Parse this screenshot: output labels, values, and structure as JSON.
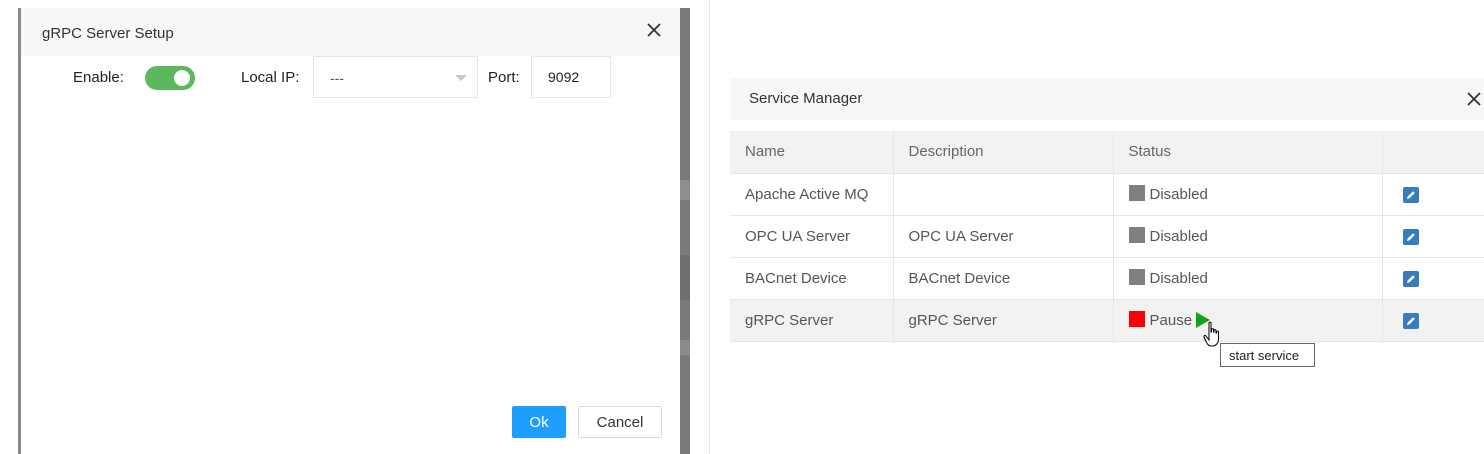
{
  "grpc_dialog": {
    "title": "gRPC Server Setup",
    "enable_label": "Enable:",
    "enabled": true,
    "local_ip_label": "Local IP:",
    "local_ip_value": "---",
    "port_label": "Port:",
    "port_value": "9092",
    "ok_label": "Ok",
    "cancel_label": "Cancel",
    "accent_color": "#1e9fff",
    "toggle_color": "#5cb85c"
  },
  "service_manager": {
    "title": "Service Manager",
    "columns": [
      "Name",
      "Description",
      "Status",
      ""
    ],
    "rows": [
      {
        "name": "Apache Active MQ",
        "description": "",
        "status": "Disabled",
        "status_color": "#808080"
      },
      {
        "name": "OPC UA Server",
        "description": "OPC UA Server",
        "status": "Disabled",
        "status_color": "#808080"
      },
      {
        "name": "BACnet Device",
        "description": "BACnet Device",
        "status": "Disabled",
        "status_color": "#808080"
      },
      {
        "name": "gRPC Server",
        "description": "gRPC Server",
        "status": "Pause",
        "status_color": "#ff0000"
      }
    ],
    "tooltip": "start service",
    "icons": {
      "edit": "edit-pencil-icon",
      "start": "play-icon",
      "close": "close-icon"
    }
  }
}
